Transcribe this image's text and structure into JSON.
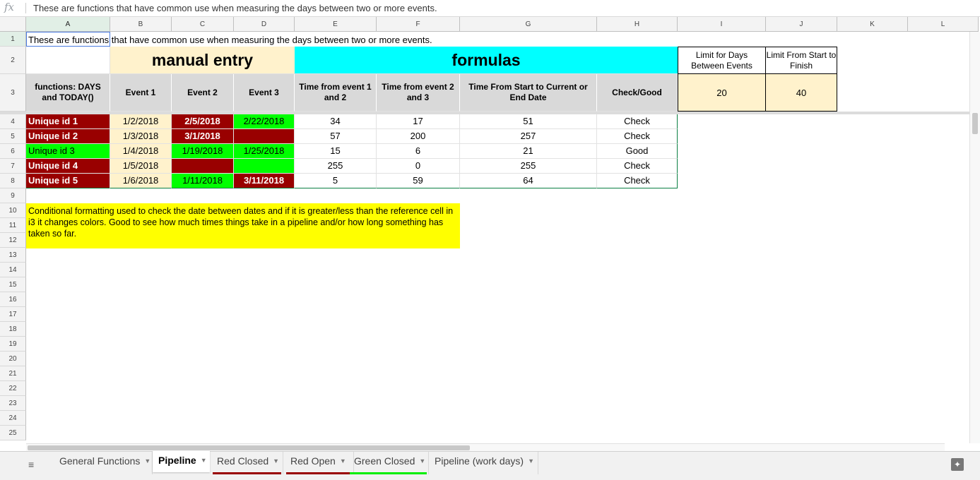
{
  "formula_bar": {
    "fx": "fx",
    "content": "These are functions that have common use when measuring the days between two or more events."
  },
  "columns": [
    "A",
    "B",
    "C",
    "D",
    "E",
    "F",
    "G",
    "H",
    "I",
    "J",
    "K",
    "L"
  ],
  "rows": [
    "1",
    "2",
    "3",
    "4",
    "5",
    "6",
    "7",
    "8",
    "9",
    "10",
    "11",
    "12",
    "13",
    "14",
    "15",
    "16",
    "17",
    "18",
    "19",
    "20",
    "21",
    "22",
    "23",
    "24",
    "25"
  ],
  "sheet": {
    "a1": "These are functions that have common use when measuring the days between two or more events.",
    "manual_entry": "manual entry",
    "formulas": "formulas",
    "limit_days": "Limit for Days Between Events",
    "limit_finish": "Limit From Start to Finish",
    "functions_header": "functions: DAYS and TODAY()",
    "event1": "Event 1",
    "event2": "Event 2",
    "event3": "Event 3",
    "time12": "Time from event 1 and 2",
    "time23": "Time from event 2 and 3",
    "time_total": "Time From Start to Current or End Date",
    "check_good": "Check/Good",
    "limit_days_value": "20",
    "limit_finish_value": "40",
    "note": "Conditional formatting used to check the date between dates and if it is greater/less than the reference cell in i3 it changes colors. Good to see how much times things take in a pipeline and/or how long something has taken so far.",
    "data": [
      {
        "id": "Unique id 1",
        "e1": "1/2/2018",
        "e2": "2/5/2018",
        "e3": "2/22/2018",
        "t12": "34",
        "t23": "17",
        "tot": "51",
        "status": "Check"
      },
      {
        "id": "Unique id 2",
        "e1": "1/3/2018",
        "e2": "3/1/2018",
        "e3": "",
        "t12": "57",
        "t23": "200",
        "tot": "257",
        "status": "Check"
      },
      {
        "id": "Unique id 3",
        "e1": "1/4/2018",
        "e2": "1/19/2018",
        "e3": "1/25/2018",
        "t12": "15",
        "t23": "6",
        "tot": "21",
        "status": "Good"
      },
      {
        "id": "Unique id 4",
        "e1": "1/5/2018",
        "e2": "",
        "e3": "",
        "t12": "255",
        "t23": "0",
        "tot": "255",
        "status": "Check"
      },
      {
        "id": "Unique id 5",
        "e1": "1/6/2018",
        "e2": "1/11/2018",
        "e3": "3/11/2018",
        "t12": "5",
        "t23": "59",
        "tot": "64",
        "status": "Check"
      }
    ]
  },
  "tabs": [
    {
      "label": "General Functions",
      "color": ""
    },
    {
      "label": "Pipeline",
      "color": ""
    },
    {
      "label": "Red Closed",
      "color": "#990000"
    },
    {
      "label": "Red Open",
      "color": "#990000"
    },
    {
      "label": "Green Closed",
      "color": "#00ee00"
    },
    {
      "label": "Pipeline (work days)",
      "color": ""
    }
  ],
  "colors": {
    "red": "#990000",
    "green": "#00ff00",
    "cream": "#fff2cc",
    "cyan": "#00ffff",
    "yellow": "#ffff00",
    "header_gray": "#d9d9d9"
  }
}
